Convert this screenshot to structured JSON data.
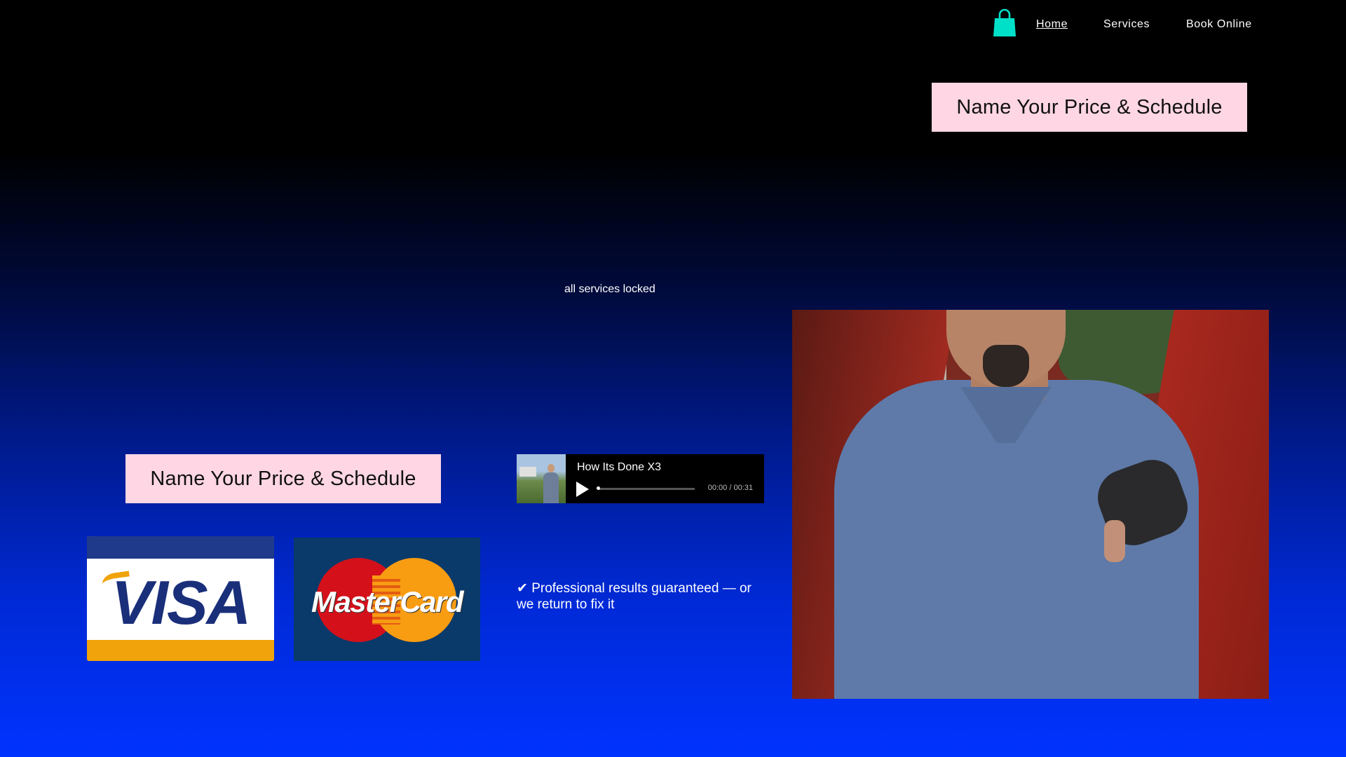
{
  "nav": {
    "cart_icon": "shopping-bag-icon",
    "cart_color": "#00e0c8",
    "links": [
      {
        "label": "Home",
        "active": true
      },
      {
        "label": "Services",
        "active": false
      },
      {
        "label": "Book Online",
        "active": false
      }
    ]
  },
  "hero": {
    "cta_label": "Name Your Price & Schedule",
    "locked_text": "all services locked"
  },
  "lower": {
    "cta_label": "Name Your Price & Schedule",
    "audio": {
      "title": "How Its Done X3",
      "time": "00:00 / 00:31",
      "progress": 0
    },
    "payment_logos": {
      "visa": "VISA",
      "mastercard": "MasterCard"
    },
    "guarantee": "✔ Professional results guaranteed — or we return to fix it"
  },
  "colors": {
    "cta_background": "#ffd6e3",
    "gradient_top": "#000000",
    "gradient_bottom": "#0033ff"
  }
}
